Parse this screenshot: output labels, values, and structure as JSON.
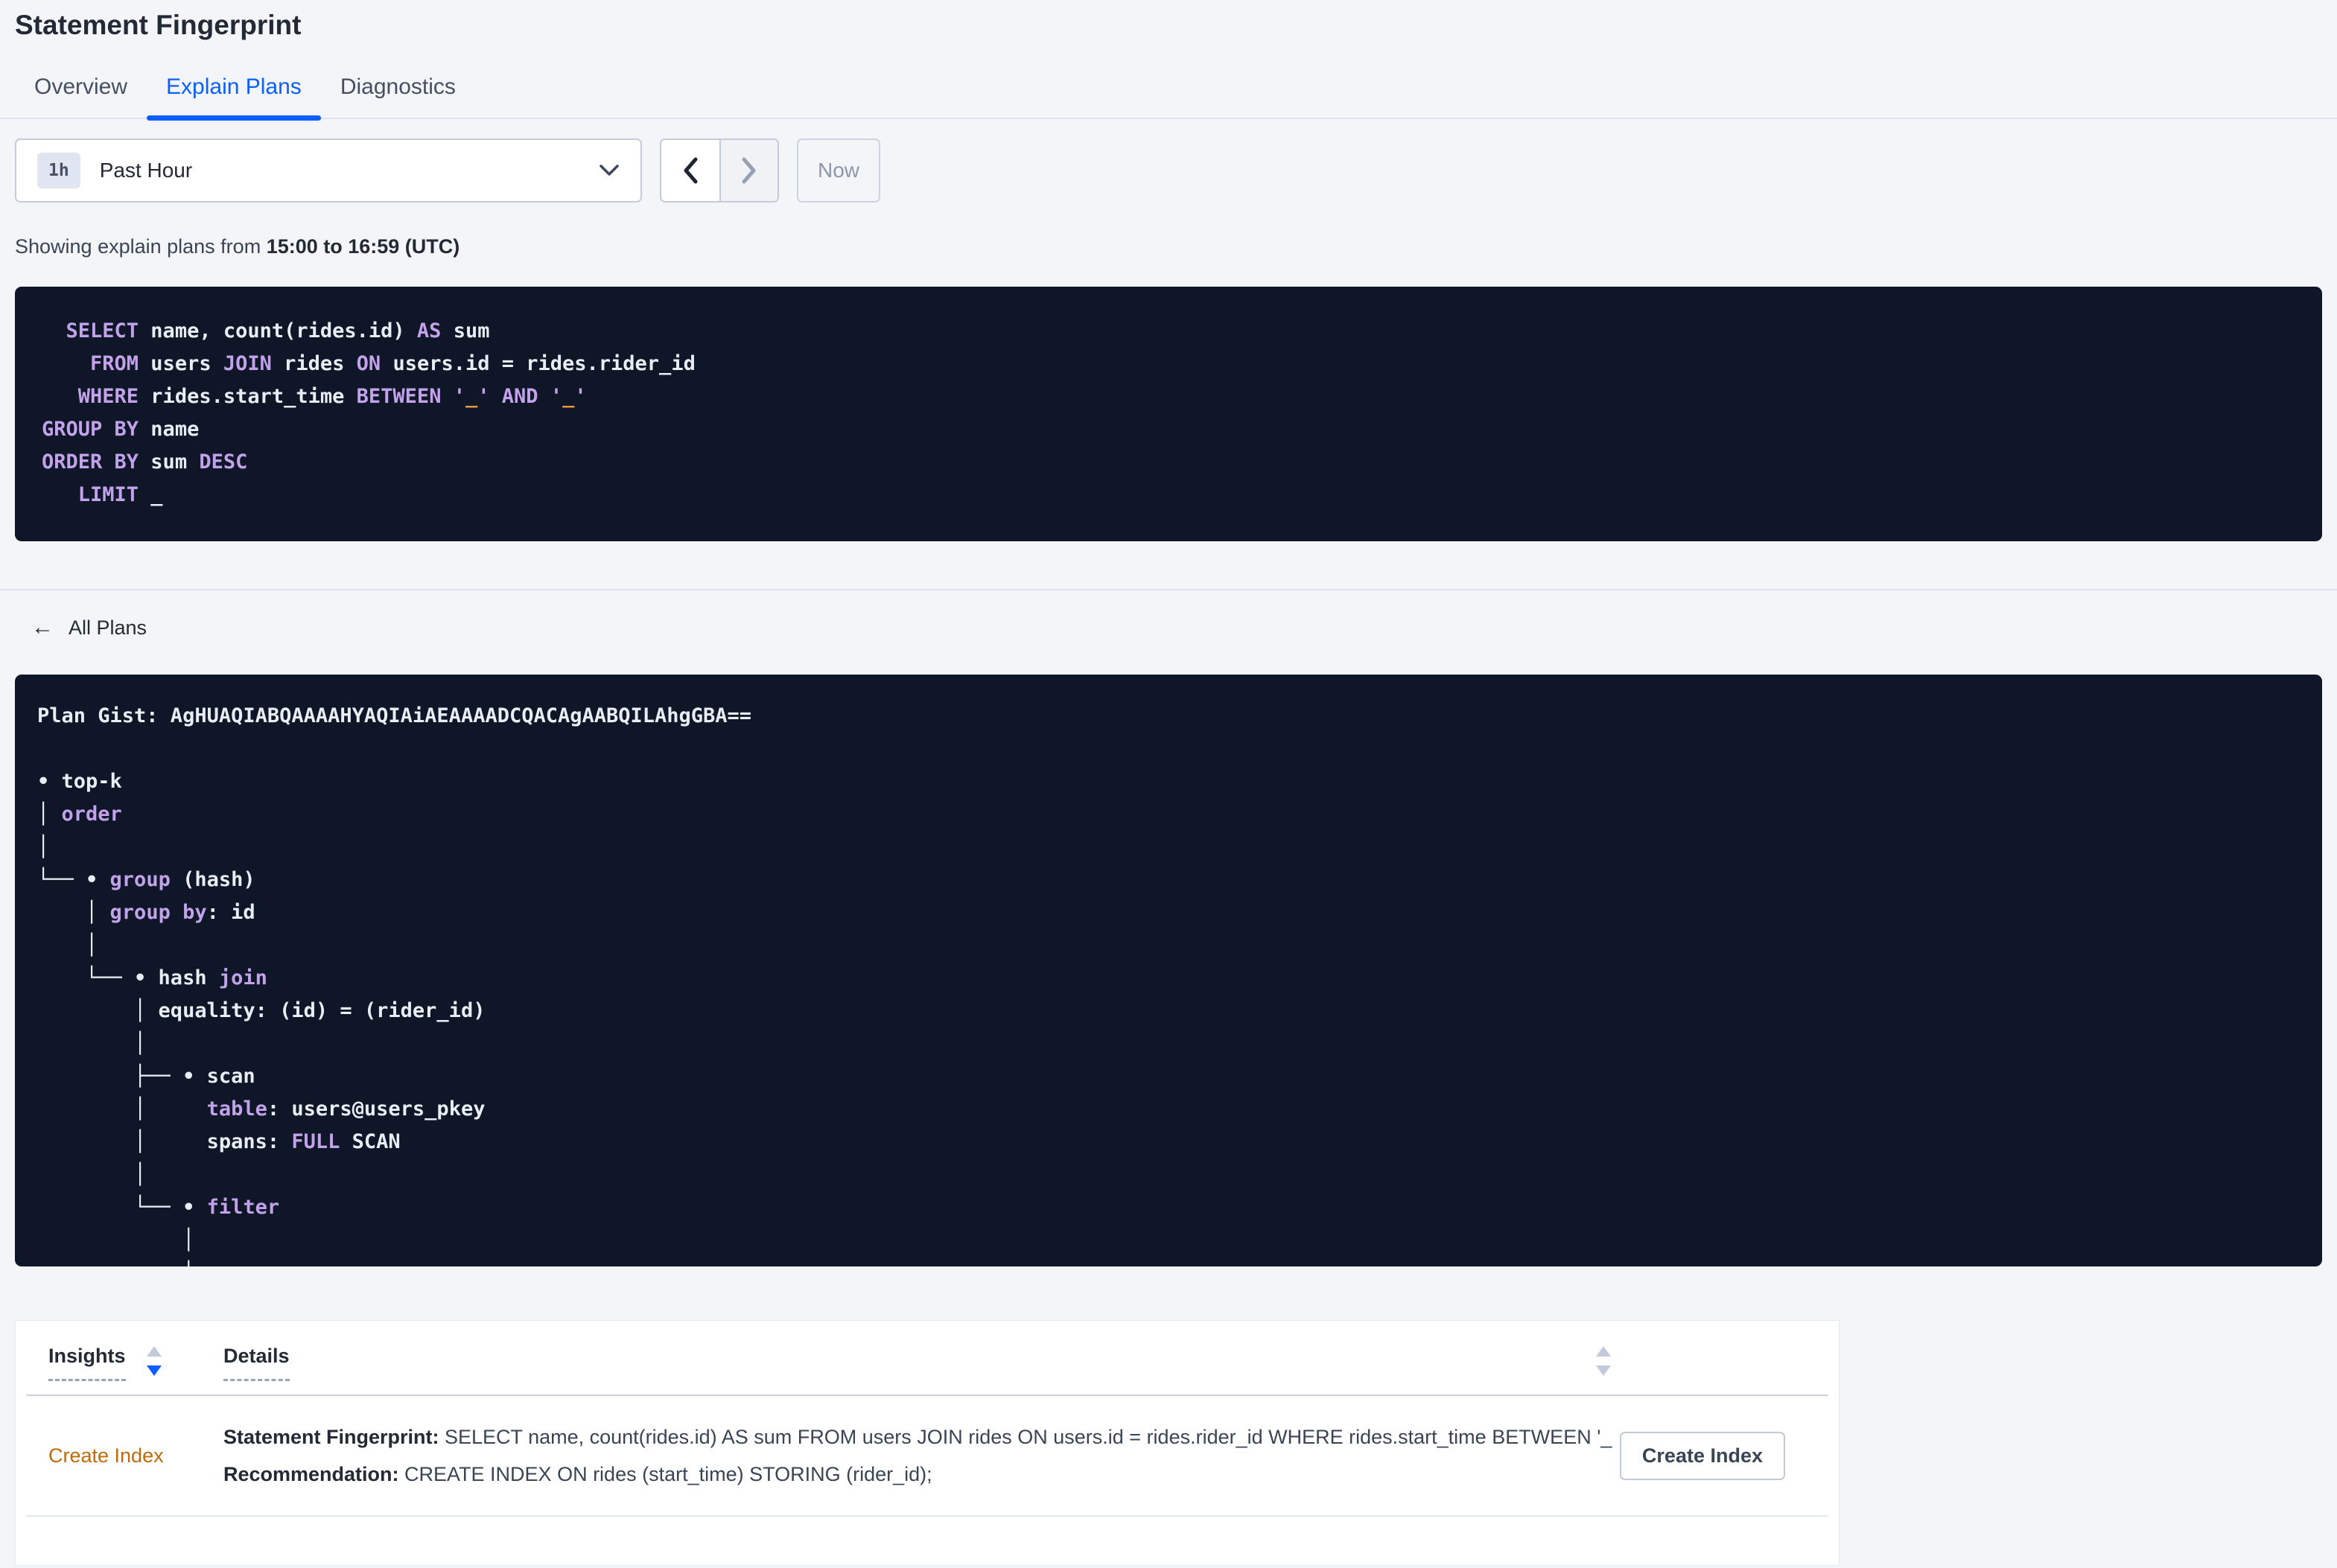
{
  "page_title": "Statement Fingerprint",
  "tabs": [
    {
      "label": "Overview",
      "active": false
    },
    {
      "label": "Explain Plans",
      "active": true
    },
    {
      "label": "Diagnostics",
      "active": false
    }
  ],
  "time_controls": {
    "interval_badge": "1h",
    "selected_range": "Past Hour",
    "now_label": "Now"
  },
  "showing_line": {
    "prefix": "Showing explain plans from",
    "range": "15:00 to 16:59 (UTC)"
  },
  "sql_box": {
    "lines": [
      [
        [
          "kw",
          "  SELECT"
        ],
        [
          "tx",
          " name, count(rides.id) "
        ],
        [
          "kw",
          "AS"
        ],
        [
          "tx",
          " sum"
        ]
      ],
      [
        [
          "kw",
          "    FROM"
        ],
        [
          "tx",
          " users "
        ],
        [
          "kw",
          "JOIN"
        ],
        [
          "tx",
          " rides "
        ],
        [
          "kw",
          "ON"
        ],
        [
          "tx",
          " users.id = rides.rider_id"
        ]
      ],
      [
        [
          "kw",
          "   WHERE"
        ],
        [
          "tx",
          " rides.start_time "
        ],
        [
          "kw",
          "BETWEEN"
        ],
        [
          "tx",
          " "
        ],
        [
          "kw",
          "'"
        ],
        [
          "ph",
          "_"
        ],
        [
          "kw",
          "'"
        ],
        [
          "tx",
          " "
        ],
        [
          "kw",
          "AND"
        ],
        [
          "tx",
          " "
        ],
        [
          "kw",
          "'"
        ],
        [
          "ph",
          "_"
        ],
        [
          "kw",
          "'"
        ]
      ],
      [
        [
          "kw",
          "GROUP BY"
        ],
        [
          "tx",
          " name"
        ]
      ],
      [
        [
          "kw",
          "ORDER BY"
        ],
        [
          "tx",
          " sum "
        ],
        [
          "kw",
          "DESC"
        ]
      ],
      [
        [
          "kw",
          "   LIMIT"
        ],
        [
          "tx",
          " _"
        ]
      ]
    ]
  },
  "back_link": {
    "label": "All Plans",
    "arrow": "←"
  },
  "plan_box": {
    "gist": "Plan Gist: AgHUAQIABQAAAAHYAQIAiAEAAAADCQACAgAABQILAhgGBA==",
    "lines": [
      [
        [
          "tx",
          "Plan Gist: AgHUAQIABQAAAAHYAQIAiAEAAAADCQACAgAABQILAhgGBA=="
        ]
      ],
      [],
      [
        [
          "tx",
          "• top-k"
        ]
      ],
      [
        [
          "tx",
          "│ "
        ],
        [
          "kw",
          "order"
        ]
      ],
      [
        [
          "tx",
          "│"
        ]
      ],
      [
        [
          "tx",
          "└── • "
        ],
        [
          "kw",
          "group"
        ],
        [
          "tx",
          " (hash)"
        ]
      ],
      [
        [
          "tx",
          "    │ "
        ],
        [
          "kw",
          "group by"
        ],
        [
          "tx",
          ": id"
        ]
      ],
      [
        [
          "tx",
          "    │"
        ]
      ],
      [
        [
          "tx",
          "    └── • hash "
        ],
        [
          "kw",
          "join"
        ]
      ],
      [
        [
          "tx",
          "        │ equality: (id) = (rider_id)"
        ]
      ],
      [
        [
          "tx",
          "        │"
        ]
      ],
      [
        [
          "tx",
          "        ├── • scan"
        ]
      ],
      [
        [
          "tx",
          "        │     "
        ],
        [
          "kw",
          "table"
        ],
        [
          "tx",
          ": users@users_pkey"
        ]
      ],
      [
        [
          "tx",
          "        │     spans: "
        ],
        [
          "kw",
          "FULL"
        ],
        [
          "tx",
          " SCAN"
        ]
      ],
      [
        [
          "tx",
          "        │"
        ]
      ],
      [
        [
          "tx",
          "        └── • "
        ],
        [
          "kw",
          "filter"
        ]
      ],
      [
        [
          "tx",
          "            │"
        ]
      ],
      [
        [
          "tx",
          "            │"
        ]
      ]
    ]
  },
  "insights_table": {
    "columns": [
      {
        "label": "Insights",
        "sort": "desc"
      },
      {
        "label": "Details",
        "sort": "none"
      }
    ],
    "rows": [
      {
        "insight": "Create Index",
        "detail_lines": [
          {
            "label": "Statement Fingerprint:",
            "text": " SELECT name, count(rides.id) AS sum FROM users JOIN rides ON users.id = rides.rider_id WHERE rides.start_time BETWEEN '_…"
          },
          {
            "label": "Recommendation:",
            "text": " CREATE INDEX ON rides (start_time) STORING (rider_id);"
          }
        ],
        "action_label": "Create Index"
      }
    ]
  },
  "colors": {
    "accent_blue": "#0b5fff",
    "code_background": "#0e1627",
    "code_keyword_purple": "#c2a2ea",
    "code_placeholder_orange": "#e8993d",
    "insight_orange": "#bf6b0b",
    "page_background": "#f4f5f9"
  }
}
